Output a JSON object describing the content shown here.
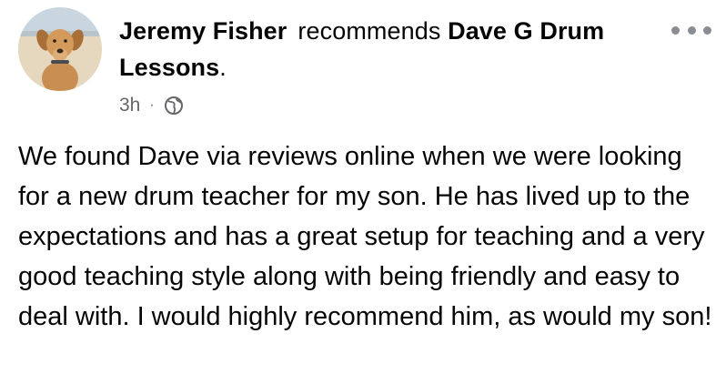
{
  "post": {
    "author": "Jeremy Fisher",
    "verb": "recommends",
    "page_name": "Dave G Drum Lessons",
    "page_suffix": ".",
    "time": "3h",
    "separator": "·",
    "audience_icon": "globe-icon",
    "more_icon": "more-options-icon",
    "body": "We found Dave via reviews online when we were looking for a new drum teacher for my son. He has lived up to the expectations and has a great setup for teaching and a very good teaching style along with being friendly and easy to deal with. I would highly recommend him, as would my son!"
  },
  "colors": {
    "text_primary": "#050505",
    "text_secondary": "#65676b",
    "icon_gray": "#8a8d91"
  }
}
